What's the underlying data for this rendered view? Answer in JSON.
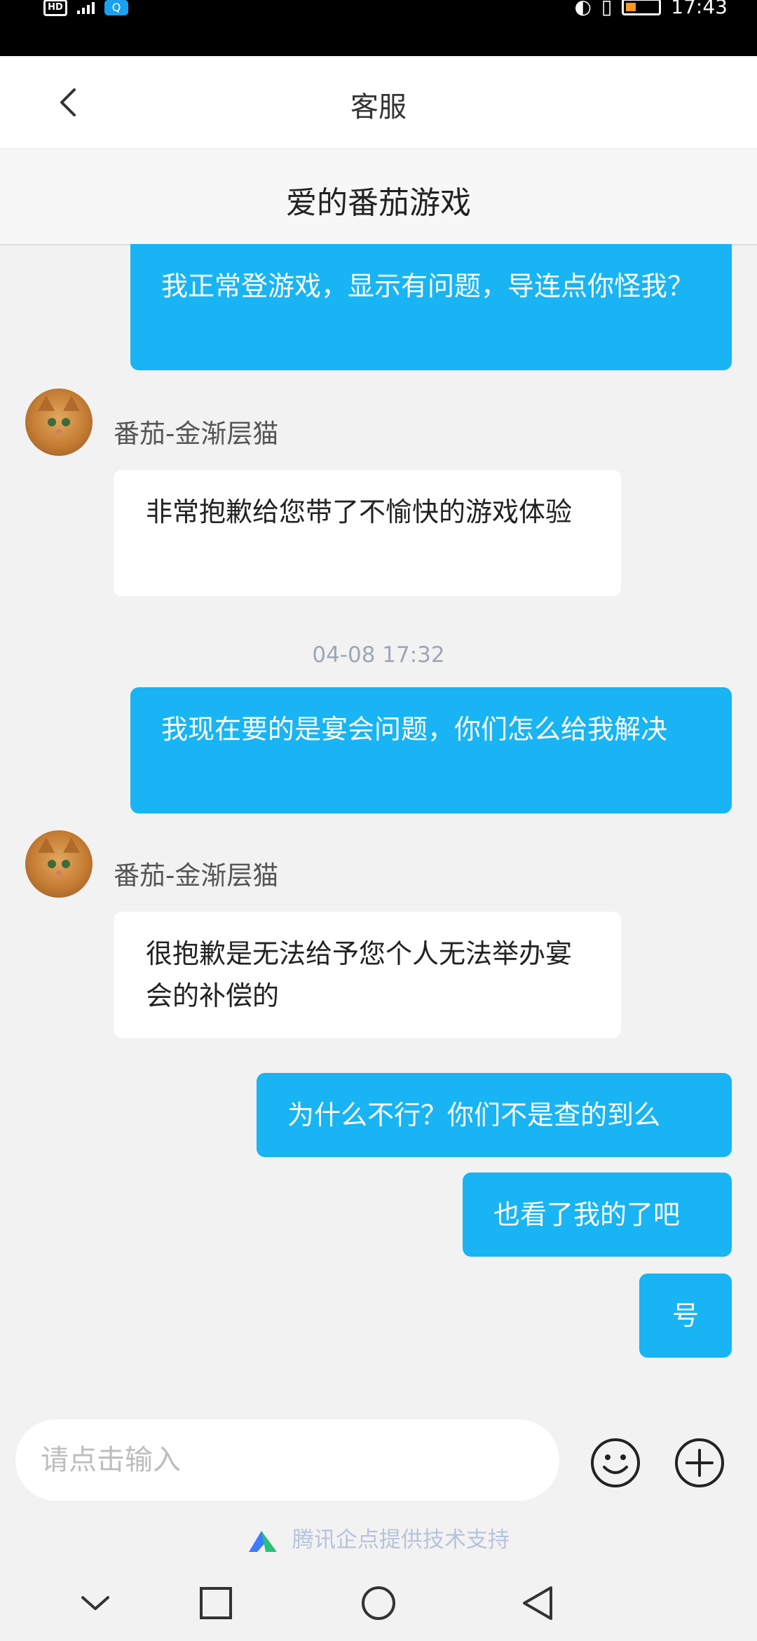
{
  "status_bar": {
    "time": "17:43",
    "left_badge": "HD"
  },
  "header": {
    "title": "客服"
  },
  "subheader": {
    "title": "爱的番茄游戏"
  },
  "messages": [
    {
      "type": "outgoing",
      "text": "我正常登游戏，显示有问题，导连点你怪我？"
    },
    {
      "type": "incoming",
      "sender": "番茄-金渐层猫",
      "text": "非常抱歉给您带了不愉快的游戏体验"
    },
    {
      "type": "timestamp",
      "text": "04-08 17:32"
    },
    {
      "type": "outgoing",
      "text": "我现在要的是宴会问题，你们怎么给我解决"
    },
    {
      "type": "incoming",
      "sender": "番茄-金渐层猫",
      "text": "很抱歉是无法给予您个人无法举办宴会的补偿的"
    },
    {
      "type": "outgoing",
      "text": "为什么不行？你们不是查的到么"
    },
    {
      "type": "outgoing",
      "text": "也看了我的了吧"
    },
    {
      "type": "outgoing",
      "text": "号"
    }
  ],
  "input": {
    "placeholder": "请点击输入",
    "value": ""
  },
  "footer": {
    "powered_by": "腾讯企点提供技术支持"
  },
  "icons": {
    "back": "chevron-left-icon",
    "emoji": "smiley-icon",
    "plus": "plus-circle-icon",
    "nav_down": "chevron-down-icon",
    "nav_recents": "square-icon",
    "nav_home": "circle-icon",
    "nav_back": "triangle-back-icon"
  },
  "colors": {
    "outgoing_bubble": "#18b4f4",
    "incoming_bubble": "#ffffff",
    "background": "#f2f2f2"
  }
}
